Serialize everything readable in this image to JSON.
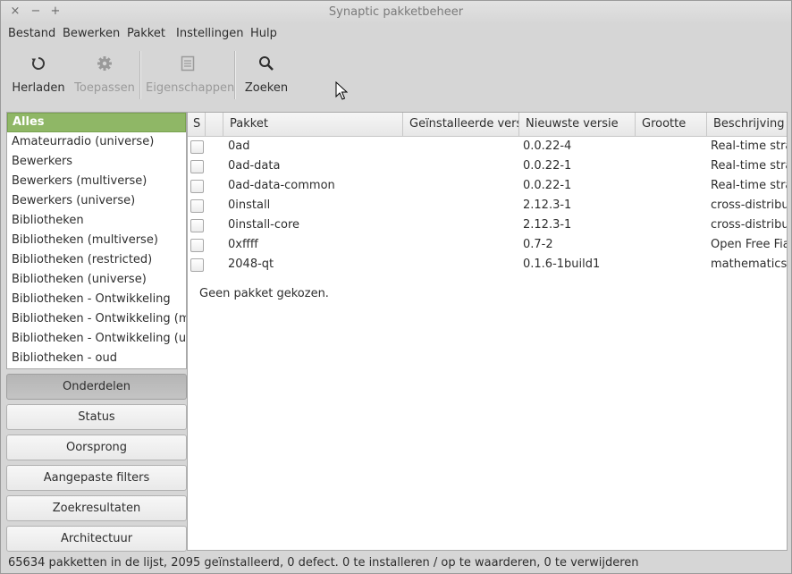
{
  "window": {
    "title": "Synaptic pakketbeheer",
    "controls": [
      "×",
      "−",
      "+"
    ]
  },
  "menubar": [
    "Bestand",
    "Bewerken",
    "Pakket",
    "Instellingen",
    "Hulp"
  ],
  "toolbar": {
    "reload": {
      "label": "Herladen",
      "icon": "reload-icon"
    },
    "apply": {
      "label": "Toepassen",
      "icon": "gear-icon"
    },
    "properties": {
      "label": "Eigenschappen",
      "icon": "properties-icon"
    },
    "search": {
      "label": "Zoeken",
      "icon": "search-icon"
    }
  },
  "sections": [
    "Alles",
    "Amateurradio (universe)",
    "Bewerkers",
    "Bewerkers (multiverse)",
    "Bewerkers (universe)",
    "Bibliotheken",
    "Bibliotheken (multiverse)",
    "Bibliotheken (restricted)",
    "Bibliotheken (universe)",
    "Bibliotheken - Ontwikkeling",
    "Bibliotheken - Ontwikkeling (multiverse)",
    "Bibliotheken - Ontwikkeling (universe)",
    "Bibliotheken - oud"
  ],
  "filter_buttons": [
    "Onderdelen",
    "Status",
    "Oorsprong",
    "Aangepaste filters",
    "Zoekresultaten",
    "Architectuur"
  ],
  "columns": [
    "S",
    "",
    "Pakket",
    "Geïnstalleerde versie",
    "Nieuwste versie",
    "Grootte",
    "Beschrijving"
  ],
  "packages": [
    {
      "name": "0ad",
      "installed": "",
      "latest": "0.0.22-4",
      "size": "",
      "description": "Real-time strategy"
    },
    {
      "name": "0ad-data",
      "installed": "",
      "latest": "0.0.22-1",
      "size": "",
      "description": "Real-time strategy"
    },
    {
      "name": "0ad-data-common",
      "installed": "",
      "latest": "0.0.22-1",
      "size": "",
      "description": "Real-time strategy"
    },
    {
      "name": "0install",
      "installed": "",
      "latest": "2.12.3-1",
      "size": "",
      "description": "cross-distribution"
    },
    {
      "name": "0install-core",
      "installed": "",
      "latest": "2.12.3-1",
      "size": "",
      "description": "cross-distribution"
    },
    {
      "name": "0xffff",
      "installed": "",
      "latest": "0.7-2",
      "size": "",
      "description": "Open Free Fiasco"
    },
    {
      "name": "2048-qt",
      "installed": "",
      "latest": "0.1.6-1build1",
      "size": "",
      "description": "mathematics based"
    }
  ],
  "details": {
    "text": "Geen pakket gekozen."
  },
  "statusbar": "65634 pakketten in de lijst, 2095 geïnstalleerd, 0 defect. 0 te installeren / op te waarderen, 0 te verwijderen",
  "colors": {
    "selection": "#8fb766",
    "window_bg": "#d6d6d6"
  }
}
